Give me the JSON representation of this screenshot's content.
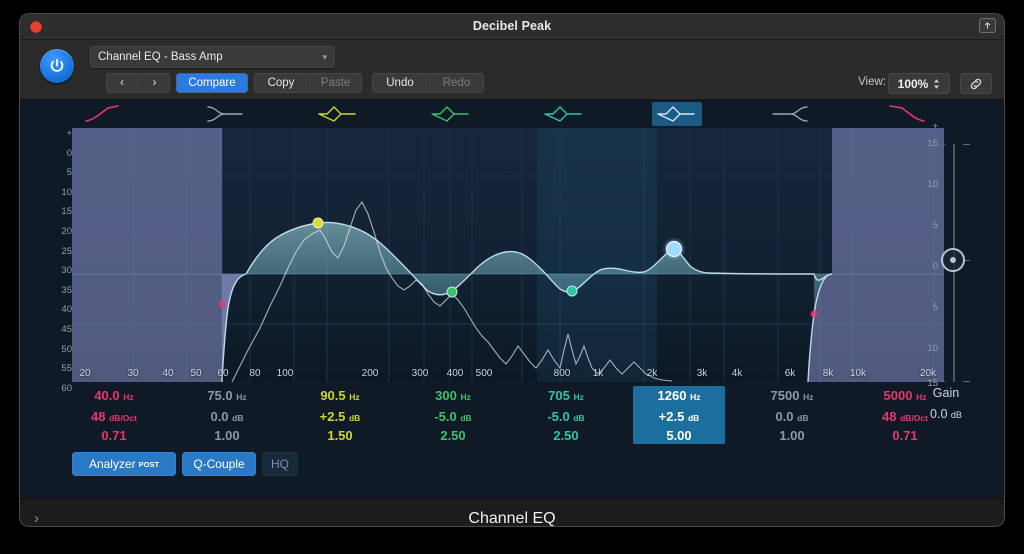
{
  "window": {
    "title": "Decibel Peak",
    "close_icon": "close-icon",
    "expand_icon": "expand-icon"
  },
  "toolbar": {
    "power_icon": "power-icon",
    "preset": "Channel EQ - Bass Amp",
    "preset_chevron": "chevron-down-icon",
    "prev_label": "‹",
    "next_label": "›",
    "compare_label": "Compare",
    "copy_label": "Copy",
    "paste_label": "Paste",
    "undo_label": "Undo",
    "redo_label": "Redo",
    "view_label": "View:",
    "view_value": "100%",
    "view_stepper_icon": "stepper-updown-icon",
    "link_icon": "link-icon"
  },
  "graph": {
    "gain_axis_caption": "Gain",
    "left_axis": [
      "+",
      "0",
      "5",
      "10",
      "15",
      "20",
      "25",
      "30",
      "35",
      "40",
      "45",
      "50",
      "55",
      "60"
    ],
    "right_axis": [
      "+",
      "15",
      "10",
      "5",
      "0",
      "5",
      "10",
      "15"
    ],
    "freq_labels": [
      "20",
      "30",
      "40",
      "50",
      "60",
      "80",
      "100",
      "200",
      "300",
      "400",
      "500",
      "800",
      "1k",
      "2k",
      "3k",
      "4k",
      "6k",
      "8k",
      "10k",
      "20k"
    ]
  },
  "bands": [
    {
      "icon": "highpass-filter-icon",
      "color": "#e8376f",
      "freq": "40.0",
      "freq_unit": "Hz",
      "gain": "48",
      "gain_unit": "dB/Oct",
      "q": "0.71",
      "selected": false
    },
    {
      "icon": "low-shelf-icon",
      "color": "#9aa7b4",
      "freq": "75.0",
      "freq_unit": "Hz",
      "gain": "0.0",
      "gain_unit": "dB",
      "q": "1.00",
      "selected": false
    },
    {
      "icon": "bell-filter-icon",
      "color": "#cfd62e",
      "freq": "90.5",
      "freq_unit": "Hz",
      "gain": "+2.5",
      "gain_unit": "dB",
      "q": "1.50",
      "selected": false
    },
    {
      "icon": "bell-filter-icon",
      "color": "#3fc06a",
      "freq": "300",
      "freq_unit": "Hz",
      "gain": "-5.0",
      "gain_unit": "dB",
      "q": "2.50",
      "selected": false
    },
    {
      "icon": "bell-filter-icon",
      "color": "#2fc4a6",
      "freq": "705",
      "freq_unit": "Hz",
      "gain": "-5.0",
      "gain_unit": "dB",
      "q": "2.50",
      "selected": false
    },
    {
      "icon": "bell-filter-icon",
      "color": "#ffffff",
      "freq": "1260",
      "freq_unit": "Hz",
      "gain": "+2.5",
      "gain_unit": "dB",
      "q": "5.00",
      "selected": true
    },
    {
      "icon": "high-shelf-icon",
      "color": "#9aa7b4",
      "freq": "7500",
      "freq_unit": "Hz",
      "gain": "0.0",
      "gain_unit": "dB",
      "q": "1.00",
      "selected": false
    },
    {
      "icon": "lowpass-filter-icon",
      "color": "#e8376f",
      "freq": "5000",
      "freq_unit": "Hz",
      "gain": "48",
      "gain_unit": "dB/Oct",
      "q": "0.71",
      "selected": false
    }
  ],
  "master": {
    "gain_title": "Gain",
    "gain_value": "0.0",
    "gain_unit": "dB"
  },
  "toggles": {
    "analyzer_label": "Analyzer",
    "analyzer_sup": "POST",
    "qcouple_label": "Q-Couple",
    "hq_label": "HQ"
  },
  "footer": {
    "title": "Channel EQ",
    "arrow_icon": "chevron-right-icon"
  },
  "colors": {
    "accent_blue": "#2a7ae2",
    "selected_band": "#1c6e9e",
    "panel_bg": "#0f1a26"
  }
}
